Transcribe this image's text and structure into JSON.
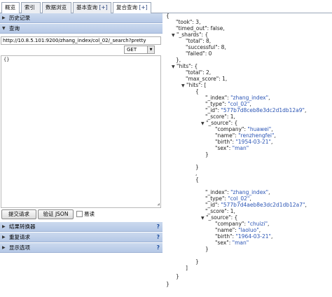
{
  "tabs": [
    {
      "label": "概览"
    },
    {
      "label": "索引"
    },
    {
      "label": "数据浏览"
    },
    {
      "label": "基本查询",
      "plus": "[+]"
    },
    {
      "label": "复合查询",
      "plus": "[+]"
    }
  ],
  "left": {
    "history_label": "历史记录",
    "query_label": "查询",
    "url_value": "http://10.8.5.101:9200/zhang_index/col_02/_search?pretty",
    "method_value": "GET",
    "body_value": "{}",
    "submit_label": "提交请求",
    "validate_label": "验证 JSON",
    "pretty_label": "易读",
    "sections": [
      {
        "label": "结果转换器"
      },
      {
        "label": "重复请求"
      },
      {
        "label": "显示选项"
      }
    ],
    "help_glyph": "?"
  },
  "json": {
    "open_brace": "{",
    "took_key": "\"took\"",
    "took_val": "3",
    "timed_out_key": "\"timed_out\"",
    "timed_out_val": "false",
    "shards_key": "\"_shards\"",
    "total_key": "\"total\"",
    "total_val": "8",
    "successful_key": "\"successful\"",
    "successful_val": "8",
    "failed_key": "\"failed\"",
    "failed_val": "0",
    "hits_key": "\"hits\"",
    "hits_total_val": "2",
    "max_score_key": "\"max_score\"",
    "max_score_val": "1",
    "index_key": "\"_index\"",
    "type_key": "\"_type\"",
    "id_key": "\"_id\"",
    "score_key": "\"_score\"",
    "source_key": "\"_source\"",
    "company_key": "\"company\"",
    "name_key": "\"name\"",
    "birth_key": "\"birth\"",
    "sex_key": "\"sex\"",
    "hit_list": [
      {
        "index": "\"zhang_index\"",
        "type": "\"col_02\"",
        "id": "\"577b7d8ceb8e3dc2d1db12a9\"",
        "score": "1",
        "company": "\"huawei\"",
        "name": "\"renzhengfei\"",
        "birth": "\"1954-03-21\"",
        "sex": "\"man\""
      },
      {
        "index": "\"zhang_index\"",
        "type": "\"col_02\"",
        "id": "\"577b7d4aeb8e3dc2d1db12a7\"",
        "score": "1",
        "company": "\"chuizi\"",
        "name": "\"laoluo\"",
        "birth": "\"1964-03-21\"",
        "sex": "\"man\""
      }
    ]
  }
}
